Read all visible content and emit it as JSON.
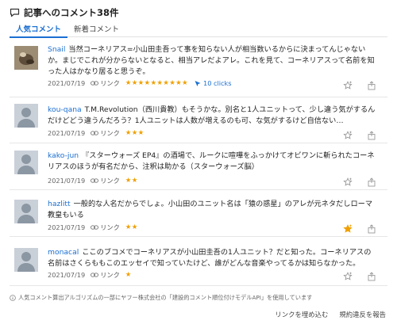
{
  "header": {
    "title": "記事へのコメント38件",
    "icon": "speech-bubble-icon"
  },
  "tabs": [
    {
      "label": "人気コメント",
      "active": true
    },
    {
      "label": "新着コメント",
      "active": false
    }
  ],
  "comments": [
    {
      "user": "Snail",
      "text": "当然コーネリアス=小山田圭吾って事を知らない人が相当数いるからに決まってんじゃないか。まじでこれが分からないとなると、相当アレだよアレ。これを見て、コーネリアスって名前を知った人はかなり居ると思うぞ。",
      "date": "2021/07/19",
      "link_label": "リンク",
      "stars": "★★★★★★★★★★",
      "clicks": "10 clicks",
      "avatar": "photo"
    },
    {
      "user": "kou-qana",
      "text": "T.M.Revolution（西川貴教）もそうかな。別名と1人ユニットって、少し違う気がするんだけどどう違うんだろう？1人ユニットは人数が増えるのも可、な気がするけど自信ない…",
      "date": "2021/07/19",
      "link_label": "リンク",
      "stars": "★★★",
      "clicks": "",
      "avatar": "default"
    },
    {
      "user": "kako-jun",
      "text": "『スターウォーズ EP4』の酒場で、ルークに喧嘩をふっかけてオビワンに斬られたコーネリアスのほうが有名だから、注釈は助かる（スターウォーズ脳）",
      "date": "2021/07/19",
      "link_label": "リンク",
      "stars": "★★",
      "clicks": "",
      "avatar": "default"
    },
    {
      "user": "hazlitt",
      "text": "一般的な人名だからでしょ。小山田のユニット名は「猿の惑星」のアレが元ネタだしローマ教皇もいる",
      "date": "2021/07/19",
      "link_label": "リンク",
      "stars": "★★",
      "clicks": "",
      "avatar": "default",
      "starred": true
    },
    {
      "user": "monacal",
      "text": "ここのブコメでコーネリアスが小山田圭吾の1人ユニット？だと知った。コーネリアスの名前はさくらももこのエッセイで知っていたけど、誰がどんな音楽やってるかは知らなかった。",
      "date": "2021/07/19",
      "link_label": "リンク",
      "stars": "★",
      "clicks": "",
      "avatar": "default"
    }
  ],
  "footer": {
    "note": "人気コメント算出アルゴリズムの一部にヤフー株式会社の「建設的コメント順位付けモデルAPI」を使用しています",
    "embed_label": "リンクを埋め込む",
    "report_label": "規約違反を報告"
  },
  "colors": {
    "accent": "#1b6fd1",
    "star": "#f0a000"
  }
}
